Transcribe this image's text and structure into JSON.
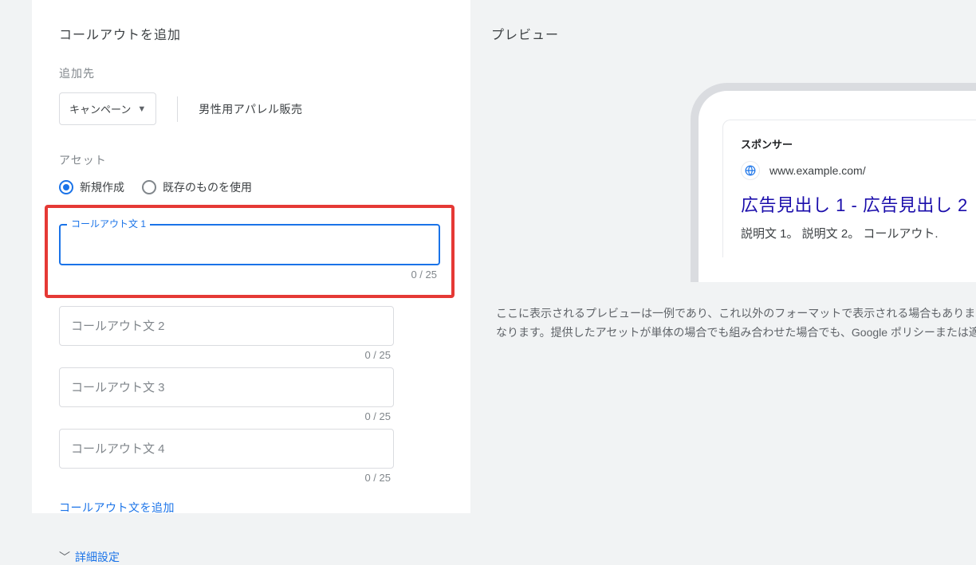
{
  "panel": {
    "title": "コールアウトを追加",
    "target_label": "追加先",
    "dropdown_label": "キャンペーン",
    "target_value": "男性用アパレル販売",
    "asset_label": "アセット",
    "radio_new": "新規作成",
    "radio_existing": "既存のものを使用",
    "callout1_label": "コールアウト文 1",
    "callout1_counter": "0 / 25",
    "callout2_placeholder": "コールアウト文 2",
    "callout2_counter": "0 / 25",
    "callout3_placeholder": "コールアウト文 3",
    "callout3_counter": "0 / 25",
    "callout4_placeholder": "コールアウト文 4",
    "callout4_counter": "0 / 25",
    "add_callout_link": "コールアウト文を追加",
    "advanced_label": "詳細設定"
  },
  "preview": {
    "title": "プレビュー",
    "sponsor": "スポンサー",
    "url": "www.example.com/",
    "headline": "広告見出し 1 - 広告見出し 2",
    "description": "説明文 1。 説明文 2。 コールアウト.",
    "disclaimer_l1": "ここに表示されるプレビューは一例であり、これ以外のフォーマットで表示される場合もあります。",
    "disclaimer_l2": "なります。提供したアセットが単体の場合でも組み合わせた場合でも、Google ポリシーまたは適用"
  }
}
